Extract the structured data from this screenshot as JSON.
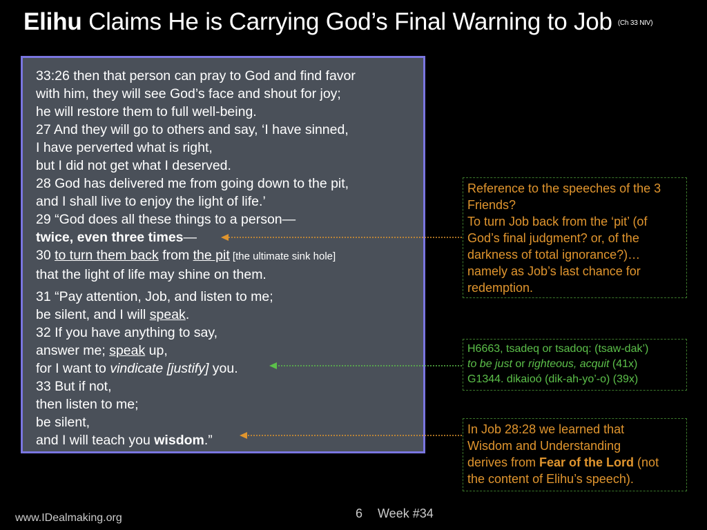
{
  "title": {
    "bold": "Elihu",
    "rest": " Claims He is Carrying God’s Final Warning to Job",
    "ref": "(Ch 33 NIV)"
  },
  "scripture": {
    "l1": "33:26 then that person can pray to God and find favor",
    "l2": "with him, they will see God’s face and shout for joy;",
    "l3": "he will restore them to full well-being.",
    "l4": "27 And they will go to others and say, ‘I have sinned,",
    "l5": "I have perverted what is right,",
    "l6": "but I did not get what I deserved.",
    "l7": "28 God has delivered me from going down to the pit,",
    "l8": "and I shall live to enjoy the light of life.’",
    "l9": "29 “God does all these things to a person—",
    "l10_bold": "twice, even three times",
    "l10_rest": "—",
    "l11_a": "30 ",
    "l11_u1": "to turn them back",
    "l11_b": " from ",
    "l11_u2": "the pit",
    "l11_small": " [the ultimate sink hole]",
    "l12": "that the light of life may shine on them.",
    "l13": "31 “Pay attention, Job, and listen to me;",
    "l14_a": "be silent, and I will ",
    "l14_u": "speak",
    "l14_b": ".",
    "l15": "32 If you have anything to say,",
    "l16_a": "answer me; ",
    "l16_u": "speak",
    "l16_b": " up,",
    "l17_a": "for I want to ",
    "l17_i": "vindicate [justify]",
    "l17_b": " you.",
    "l18": "33 But if not,",
    "l19": "then listen to me;",
    "l20": "be silent,",
    "l21_a": "and I will teach you ",
    "l21_bold": "wisdom",
    "l21_b": ".”"
  },
  "note1": {
    "l1": "Reference to the speeches of the 3",
    "l2": "Friends?",
    "l3": "To turn Job back from the ‘pit’ (of",
    "l4": "God’s final judgment? or, of the",
    "l5": "darkness of total ignorance?)…",
    "l6": "namely as Job’s last chance for",
    "l7": "redemption."
  },
  "note2": {
    "l1": "H6663, tsadeq or tsadoq:  (tsaw-dak’)",
    "l2_i1": "to be just",
    "l2_a": " or ",
    "l2_i2": "righteous, acquit",
    "l2_b": " (41x)",
    "l3": "G1344. dikaioó (dik-ah-yo’-o)  (39x)"
  },
  "note3": {
    "l1": "In Job 28:28 we learned that",
    "l2": "Wisdom and Understanding",
    "l3_a": "derives from ",
    "l3_bold": "Fear of the Lord",
    "l3_b": " (not",
    "l4": "the content of Elihu’s speech)."
  },
  "footer": {
    "website": "www.IDealmaking.org",
    "page": "6",
    "week": "Week #34"
  },
  "colors": {
    "accent_orange": "#e0952e",
    "accent_green": "#5cc04a",
    "box_border": "#7a76e0",
    "box_fill": "#4a5059"
  }
}
